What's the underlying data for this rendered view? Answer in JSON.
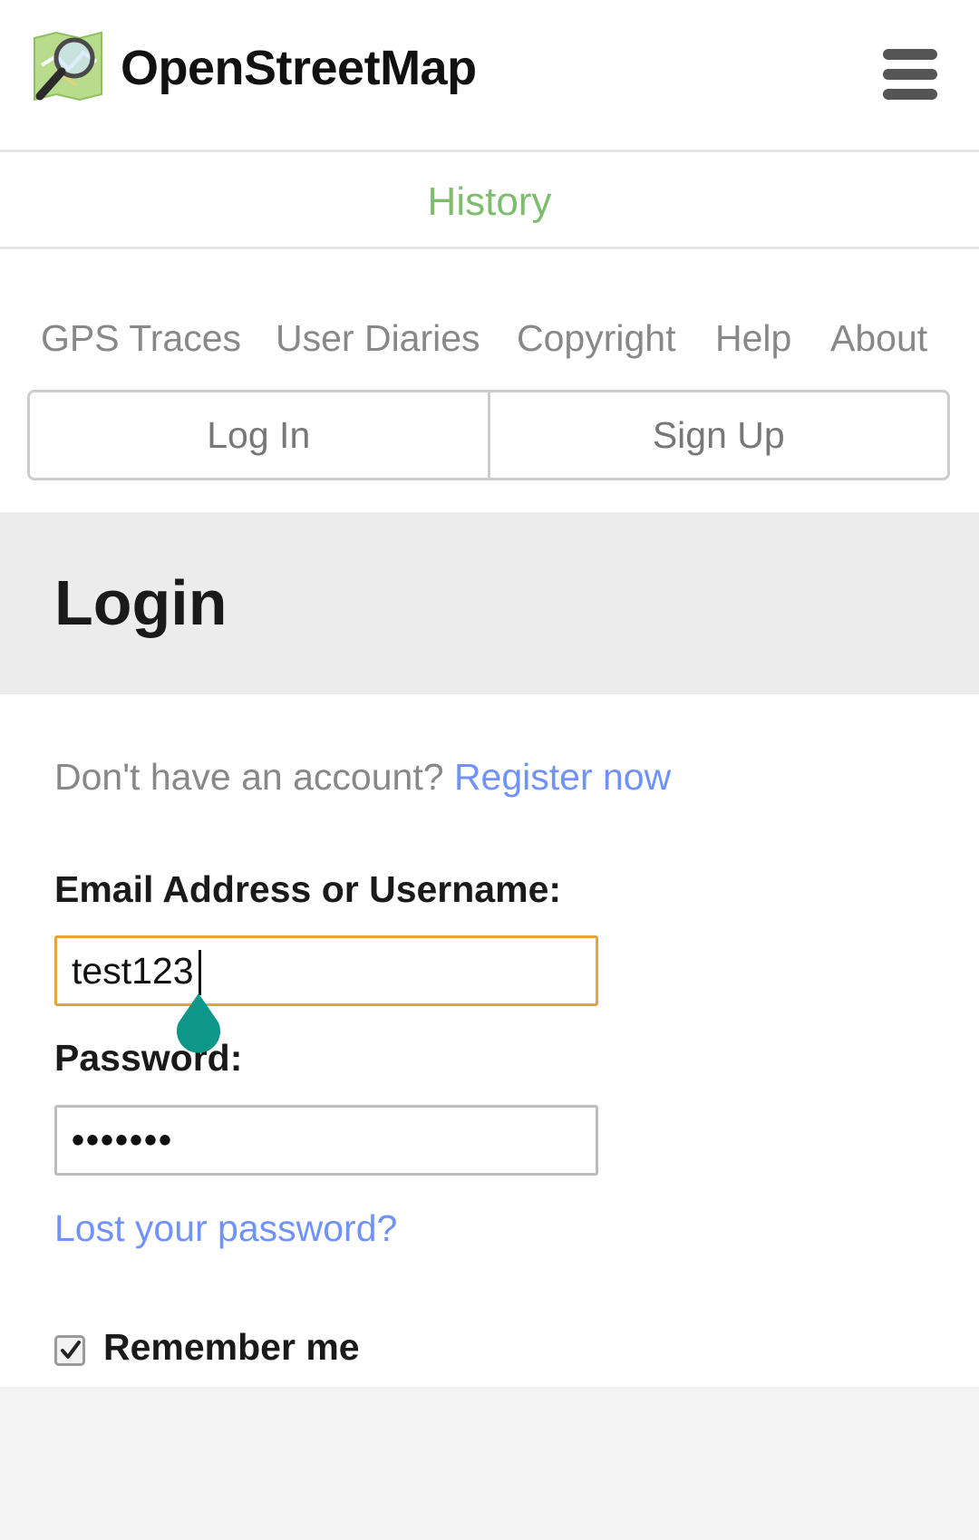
{
  "header": {
    "brand": "OpenStreetMap",
    "logo_icon": "openstreetmap-logo-icon",
    "menu_icon": "hamburger-menu-icon"
  },
  "history_tab": {
    "label": "History"
  },
  "nav": {
    "links": [
      "GPS Traces",
      "User Diaries",
      "Copyright",
      "Help",
      "About"
    ],
    "login_button": "Log In",
    "signup_button": "Sign Up"
  },
  "login": {
    "title": "Login",
    "no_account_text": "Don't have an account?",
    "register_link": "Register now",
    "email_label": "Email Address or Username:",
    "email_value": "test123",
    "password_label": "Password:",
    "password_value": "•••••••",
    "lost_password_link": "Lost your password?",
    "remember_label": "Remember me",
    "remember_checked": true
  },
  "colors": {
    "accent_green": "#7ebc6f",
    "link_blue": "#7092ff",
    "focus_orange": "#e6a23c",
    "text_cursor_handle": "#0e9688"
  }
}
